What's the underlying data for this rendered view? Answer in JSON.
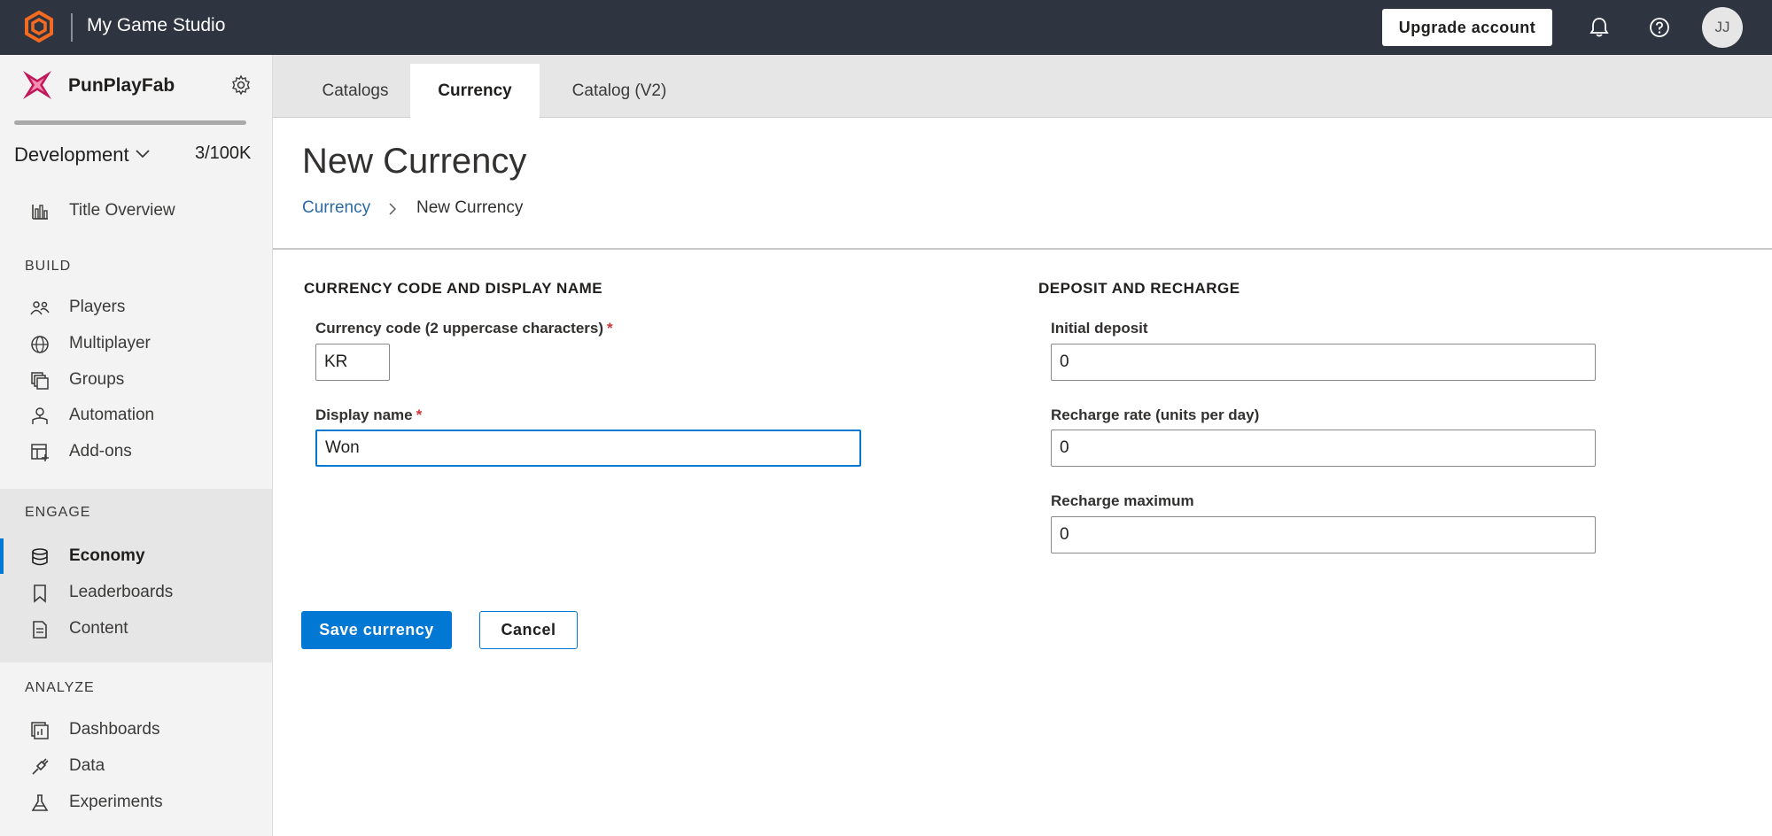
{
  "header": {
    "studio_name": "My Game Studio",
    "upgrade_label": "Upgrade account",
    "avatar_initials": "JJ",
    "logo_icon": "playfab-hex-logo-icon",
    "colors": {
      "bar": "#2e3440",
      "logo": "#f26b21"
    }
  },
  "sidebar": {
    "title_name": "PunPlayFab",
    "environment": "Development",
    "player_count": "3/100K",
    "overview": {
      "label": "Title Overview",
      "icon": "bar-chart-icon"
    },
    "sections": {
      "build": "BUILD",
      "engage": "ENGAGE",
      "analyze": "ANALYZE"
    },
    "build_items": [
      {
        "label": "Players",
        "icon": "people-icon"
      },
      {
        "label": "Multiplayer",
        "icon": "globe-icon"
      },
      {
        "label": "Groups",
        "icon": "groups-icon"
      },
      {
        "label": "Automation",
        "icon": "robot-icon"
      },
      {
        "label": "Add-ons",
        "icon": "addons-icon"
      }
    ],
    "engage_items": [
      {
        "label": "Economy",
        "icon": "database-icon",
        "active": true
      },
      {
        "label": "Leaderboards",
        "icon": "bookmark-icon"
      },
      {
        "label": "Content",
        "icon": "document-icon"
      }
    ],
    "analyze_items": [
      {
        "label": "Dashboards",
        "icon": "dashboard-icon"
      },
      {
        "label": "Data",
        "icon": "plug-icon"
      },
      {
        "label": "Experiments",
        "icon": "flask-icon"
      }
    ]
  },
  "tabs": [
    {
      "label": "Catalogs",
      "active": false
    },
    {
      "label": "Currency",
      "active": true
    },
    {
      "label": "Catalog (V2)",
      "active": false
    }
  ],
  "page": {
    "title": "New Currency",
    "breadcrumb_link": "Currency",
    "breadcrumb_current": "New Currency"
  },
  "form": {
    "code_section_title": "CURRENCY CODE AND DISPLAY NAME",
    "deposit_section_title": "DEPOSIT AND RECHARGE",
    "currency_code_label": "Currency code (2 uppercase characters)",
    "currency_code_value": "KR",
    "display_name_label": "Display name",
    "display_name_value": "Won",
    "initial_deposit_label": "Initial deposit",
    "initial_deposit_value": "0",
    "recharge_rate_label": "Recharge rate (units per day)",
    "recharge_rate_value": "0",
    "recharge_max_label": "Recharge maximum",
    "recharge_max_value": "0",
    "required_mark": "*",
    "save_label": "Save currency",
    "cancel_label": "Cancel",
    "accent_color": "#0078d4"
  }
}
